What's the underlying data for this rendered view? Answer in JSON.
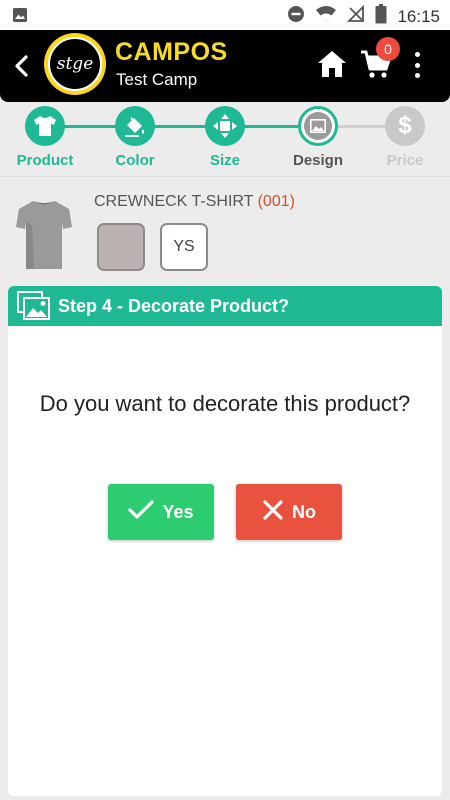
{
  "status_bar": {
    "time": "16:15"
  },
  "header": {
    "logo_text": "stge",
    "title": "CAMPOS",
    "subtitle": "Test Camp",
    "cart_count": "0"
  },
  "steps": [
    {
      "label": "Product",
      "state": "done",
      "icon": "tshirt-icon"
    },
    {
      "label": "Color",
      "state": "done",
      "icon": "paint-bucket-icon"
    },
    {
      "label": "Size",
      "state": "done",
      "icon": "resize-arrows-icon"
    },
    {
      "label": "Design",
      "state": "current",
      "icon": "image-icon"
    },
    {
      "label": "Price",
      "state": "todo",
      "icon": "dollar-icon"
    }
  ],
  "product": {
    "name": "CREWNECK T-SHIRT",
    "code": "(001)",
    "color_hex": "#b9b2b0",
    "size": "YS"
  },
  "dialog": {
    "title": "Step 4 - Decorate Product?",
    "question": "Do you want to decorate this product?",
    "yes_label": "Yes",
    "no_label": "No"
  },
  "colors": {
    "accent": "#1fb996",
    "brand_yellow": "#f7dc1f",
    "yes": "#2ecc71",
    "no": "#e8523f",
    "inactive": "#bdbdbd"
  }
}
